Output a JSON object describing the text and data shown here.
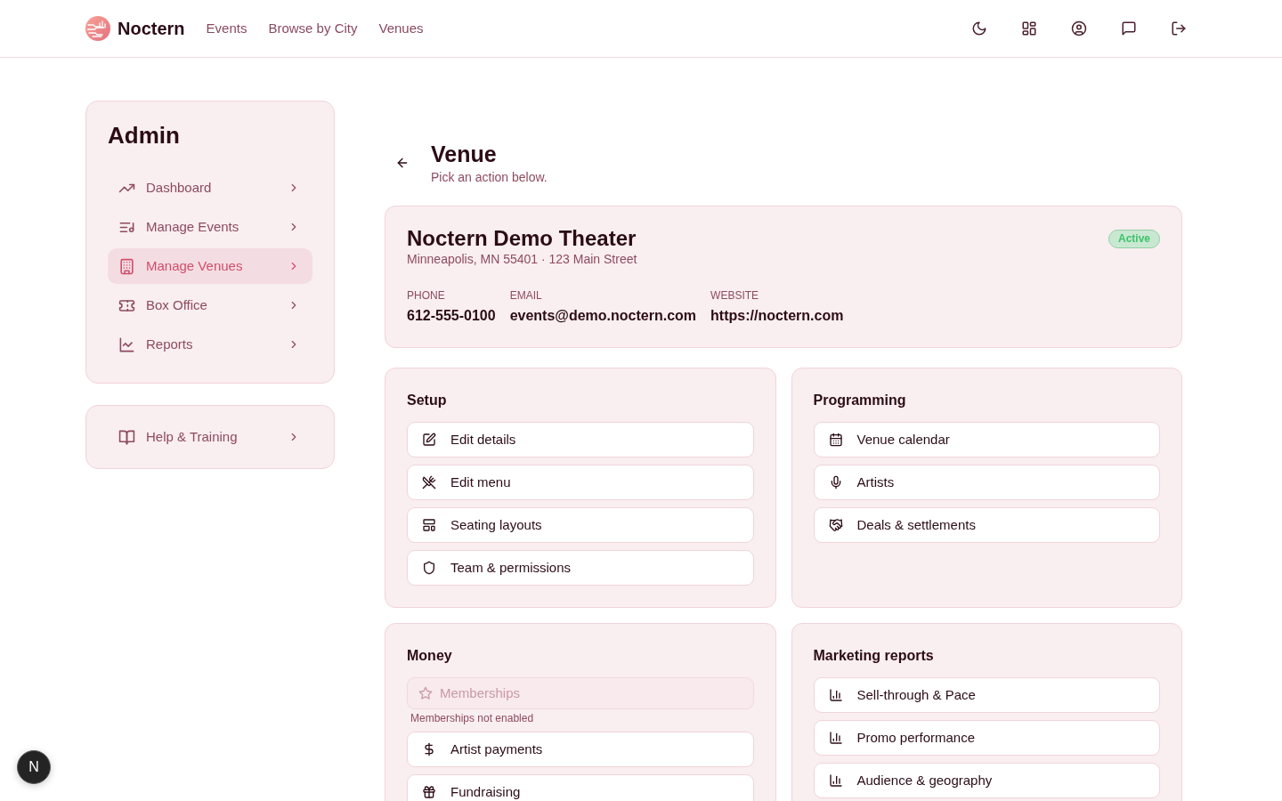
{
  "navbar": {
    "brand": "Noctern",
    "links": [
      {
        "label": "Events"
      },
      {
        "label": "Browse by City"
      },
      {
        "label": "Venues"
      }
    ]
  },
  "sidebar": {
    "title": "Admin",
    "items": [
      {
        "label": "Dashboard",
        "selected": false
      },
      {
        "label": "Manage Events",
        "selected": false
      },
      {
        "label": "Manage Venues",
        "selected": true
      },
      {
        "label": "Box Office",
        "selected": false
      },
      {
        "label": "Reports",
        "selected": false
      }
    ]
  },
  "help": {
    "items": [
      {
        "label": "Help & Training"
      }
    ]
  },
  "page": {
    "title": "Venue",
    "subtitle": "Pick an action below."
  },
  "venue": {
    "name": "Noctern Demo Theater",
    "address": "Minneapolis, MN 55401 · 123 Main Street",
    "status": "Active",
    "fields": [
      {
        "label": "PHONE",
        "value": "612-555-0100"
      },
      {
        "label": "EMAIL",
        "value": "events@demo.noctern.com"
      },
      {
        "label": "WEBSITE",
        "value": "https://noctern.com"
      }
    ]
  },
  "sections": [
    {
      "title": "Setup",
      "actions": [
        {
          "label": "Edit details",
          "disabled": false
        },
        {
          "label": "Edit menu",
          "disabled": false
        },
        {
          "label": "Seating layouts",
          "disabled": false
        },
        {
          "label": "Team & permissions",
          "disabled": false
        }
      ]
    },
    {
      "title": "Programming",
      "actions": [
        {
          "label": "Venue calendar",
          "disabled": false
        },
        {
          "label": "Artists",
          "disabled": false
        },
        {
          "label": "Deals & settlements",
          "disabled": false
        }
      ]
    },
    {
      "title": "Money",
      "actions": [
        {
          "label": "Memberships",
          "disabled": true,
          "note": "Memberships not enabled"
        },
        {
          "label": "Artist payments",
          "disabled": false
        },
        {
          "label": "Fundraising",
          "disabled": false
        }
      ]
    },
    {
      "title": "Marketing reports",
      "actions": [
        {
          "label": "Sell-through & Pace",
          "disabled": false
        },
        {
          "label": "Promo performance",
          "disabled": false
        },
        {
          "label": "Audience & geography",
          "disabled": false
        }
      ]
    }
  ],
  "dev_badge": {
    "label": "N"
  }
}
